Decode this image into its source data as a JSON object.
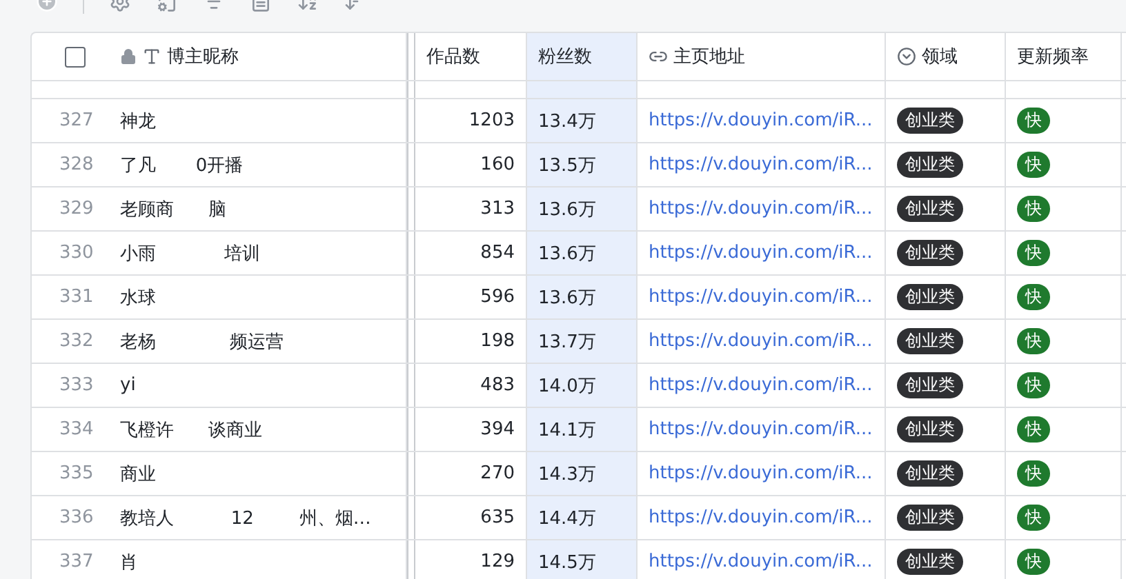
{
  "header": {
    "select_all": {
      "checked": false
    },
    "columns": [
      {
        "kind": "name",
        "label": "博主昵称",
        "locked": true,
        "selected": false
      },
      {
        "kind": "number",
        "label": "作品数",
        "selected": false
      },
      {
        "kind": "number",
        "label": "粉丝数",
        "selected": true
      },
      {
        "kind": "link",
        "label": "主页地址",
        "selected": false
      },
      {
        "kind": "select",
        "label": "领域",
        "selected": false
      },
      {
        "kind": "plain",
        "label": "更新频率",
        "selected": false
      }
    ]
  },
  "rows": [
    {
      "index": "327",
      "name": "神龙",
      "works": "1203",
      "fans": "13.4万",
      "url": "https://v.douyin.com/iR...",
      "domain": "创业类",
      "frequency": "快"
    },
    {
      "index": "328",
      "name": "了凡       0开播",
      "works": "160",
      "fans": "13.5万",
      "url": "https://v.douyin.com/iR...",
      "domain": "创业类",
      "frequency": "快"
    },
    {
      "index": "329",
      "name": "老顾商      脑",
      "works": "313",
      "fans": "13.6万",
      "url": "https://v.douyin.com/iR...",
      "domain": "创业类",
      "frequency": "快"
    },
    {
      "index": "330",
      "name": "小雨            培训",
      "works": "854",
      "fans": "13.6万",
      "url": "https://v.douyin.com/iR...",
      "domain": "创业类",
      "frequency": "快"
    },
    {
      "index": "331",
      "name": "水球",
      "works": "596",
      "fans": "13.6万",
      "url": "https://v.douyin.com/iR...",
      "domain": "创业类",
      "frequency": "快"
    },
    {
      "index": "332",
      "name": "老杨             频运营",
      "works": "198",
      "fans": "13.7万",
      "url": "https://v.douyin.com/iR...",
      "domain": "创业类",
      "frequency": "快"
    },
    {
      "index": "333",
      "name": "yi",
      "works": "483",
      "fans": "14.0万",
      "url": "https://v.douyin.com/iR...",
      "domain": "创业类",
      "frequency": "快"
    },
    {
      "index": "334",
      "name": "飞橙许      谈商业",
      "works": "394",
      "fans": "14.1万",
      "url": "https://v.douyin.com/iR...",
      "domain": "创业类",
      "frequency": "快"
    },
    {
      "index": "335",
      "name": "商业",
      "works": "270",
      "fans": "14.3万",
      "url": "https://v.douyin.com/iR...",
      "domain": "创业类",
      "frequency": "快"
    },
    {
      "index": "336",
      "name": "教培人          12        州、烟…",
      "works": "635",
      "fans": "14.4万",
      "url": "https://v.douyin.com/iR...",
      "domain": "创业类",
      "frequency": "快"
    },
    {
      "index": "337",
      "name": "肖",
      "works": "129",
      "fans": "14.5万",
      "url": "https://v.douyin.com/iR...",
      "domain": "创业类",
      "frequency": "快"
    }
  ]
}
